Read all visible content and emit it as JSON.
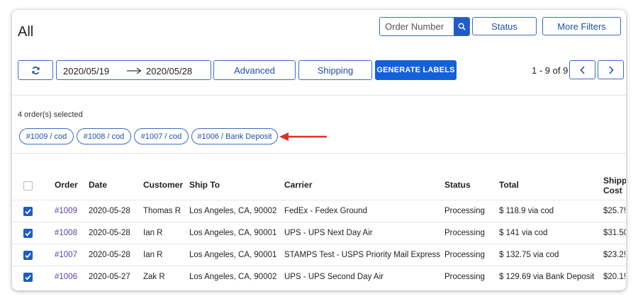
{
  "header": {
    "title": "All",
    "search_placeholder": "Order Number",
    "status_label": "Status",
    "more_filters_label": "More Filters"
  },
  "toolbar": {
    "date_from": "2020/05/19",
    "date_to": "2020/05/28",
    "advanced_label": "Advanced",
    "shipping_label": "Shipping",
    "generate_labels_label": "GENERATE LABELS",
    "pagination": "1 - 9 of 9"
  },
  "selection": {
    "count_text": "4 order(s) selected",
    "chips": [
      "#1009 / cod",
      "#1008 / cod",
      "#1007 / cod",
      "#1006 / Bank Deposit"
    ]
  },
  "table": {
    "columns": [
      "Order",
      "Date",
      "Customer",
      "Ship To",
      "Carrier",
      "Status",
      "Total",
      "Shippi",
      "Cost"
    ],
    "rows": [
      {
        "order": "#1009",
        "date": "2020-05-28",
        "customer": "Thomas R",
        "ship_to": "Los Angeles, CA, 90002",
        "carrier": "FedEx - Fedex Ground",
        "status": "Processing",
        "total": "$ 118.9 via cod",
        "shipping_cost": "$25.7!"
      },
      {
        "order": "#1008",
        "date": "2020-05-28",
        "customer": "Ian R",
        "ship_to": "Los Angeles, CA, 90001",
        "carrier": "UPS - UPS Next Day Air",
        "status": "Processing",
        "total": "$ 141 via cod",
        "shipping_cost": "$31.50"
      },
      {
        "order": "#1007",
        "date": "2020-05-28",
        "customer": "Ian R",
        "ship_to": "Los Angeles, CA, 90001",
        "carrier": "STAMPS Test - USPS Priority Mail Express",
        "status": "Processing",
        "total": "$ 132.75 via cod",
        "shipping_cost": "$23.2!"
      },
      {
        "order": "#1006",
        "date": "2020-05-27",
        "customer": "Zak R",
        "ship_to": "Los Angeles, CA, 90002",
        "carrier": "UPS - UPS Second Day Air",
        "status": "Processing",
        "total": "$ 129.69 via Bank Deposit",
        "shipping_cost": "$20.1!"
      }
    ]
  },
  "colors": {
    "accent": "#1460d8",
    "annotation_arrow": "#d9312b",
    "link": "#5a3fa8"
  }
}
